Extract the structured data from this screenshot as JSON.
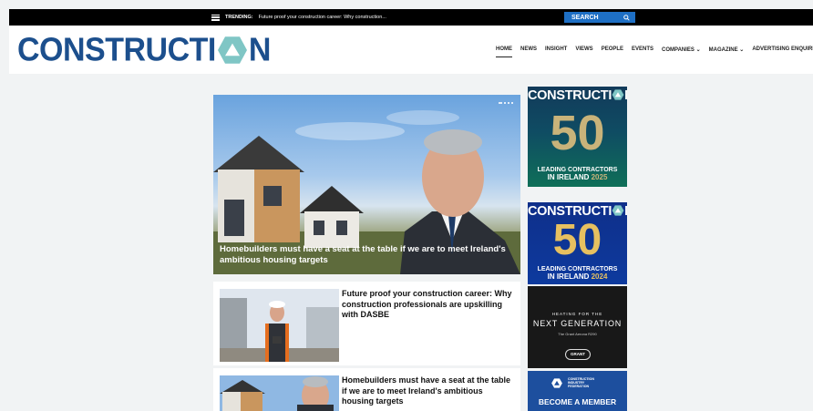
{
  "topbar": {
    "trending_label": "TRENDING:",
    "trending_text": "Future proof your construction career: Why construction...",
    "search_label": "SEARCH"
  },
  "header": {
    "logo_left": "CONSTRUCTI",
    "logo_right": "N",
    "nav": [
      "HOME",
      "NEWS",
      "INSIGHT",
      "VIEWS",
      "PEOPLE",
      "EVENTS",
      "COMPANIES ⌄",
      "MAGAZINE ⌄",
      "ADVERTISING ENQUIRIES"
    ]
  },
  "hero": {
    "caption": "Homebuilders must have a seat at the table if we are to meet Ireland's ambitious housing targets"
  },
  "articles": [
    {
      "title": "Future proof your construction career: Why construction professionals are upskilling with DASBE"
    },
    {
      "title": "Homebuilders must have a seat at the table if we are to meet Ireland's ambitious housing targets"
    }
  ],
  "sidebar": {
    "ad1": {
      "title_left": "CONSTRUCTI",
      "title_right": "N",
      "number": "50",
      "line1": "LEADING CONTRACTORS",
      "line2": "IN IRELAND",
      "year": "2025"
    },
    "ad2": {
      "title_left": "CONSTRUCTI",
      "title_right": "N",
      "number": "50",
      "line1": "LEADING CONTRACTORS",
      "line2": "IN IRELAND",
      "year": "2024"
    },
    "ad3": {
      "small": "HEATING FOR THE",
      "big": "NEXT GENERATION",
      "sub": "The Grant Aerona R290",
      "brand": "GRANT"
    },
    "ad4": {
      "org": "CONSTRUCTION INDUSTRY FEDERATION",
      "cta": "BECOME A MEMBER"
    }
  },
  "colors": {
    "brand_blue": "#1c4f8d",
    "logo_teal": "#7fc6c5",
    "search_blue": "#1e6fc4"
  }
}
